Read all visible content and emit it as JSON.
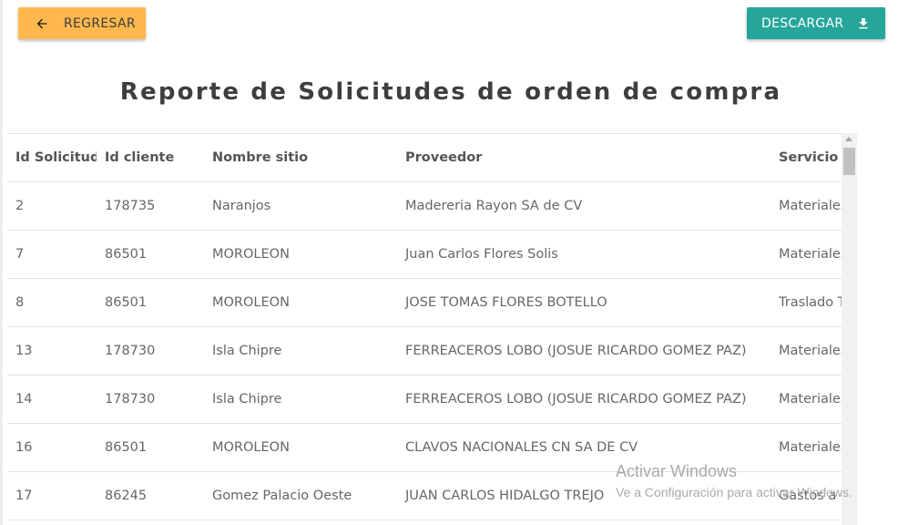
{
  "toolbar": {
    "back_label": "REGRESAR",
    "download_label": "DESCARGAR"
  },
  "report": {
    "title": "Reporte de Solicitudes de orden de compra"
  },
  "table": {
    "columns": [
      "Id Solicitud",
      "Id cliente",
      "Nombre sitio",
      "Proveedor",
      "Servicio"
    ],
    "rows": [
      [
        "2",
        "178735",
        "Naranjos",
        "Madereria Rayon SA de CV",
        "Materiales"
      ],
      [
        "7",
        "86501",
        "MOROLEON",
        "Juan Carlos Flores Solis",
        "Materiales"
      ],
      [
        "8",
        "86501",
        "MOROLEON",
        "JOSE TOMAS FLORES BOTELLO",
        "Traslado To"
      ],
      [
        "13",
        "178730",
        "Isla Chipre",
        "FERREACEROS LOBO (JOSUE RICARDO GOMEZ PAZ)",
        "Materiales"
      ],
      [
        "14",
        "178730",
        "Isla Chipre",
        "FERREACEROS LOBO (JOSUE RICARDO GOMEZ PAZ)",
        "Materiales"
      ],
      [
        "16",
        "86501",
        "MOROLEON",
        "CLAVOS NACIONALES CN SA DE CV",
        "Materiales"
      ],
      [
        "17",
        "86245",
        "Gomez Palacio Oeste",
        "JUAN CARLOS HIDALGO TREJO",
        "Gastos a C"
      ]
    ]
  },
  "watermark": {
    "line1": "Activar Windows",
    "line2": "Ve a Configuración para activar Windows."
  },
  "colors": {
    "back_button": "#ffb84d",
    "download_button": "#26a69a"
  },
  "icons": {
    "back": "arrow-left-icon",
    "download": "download-icon"
  }
}
